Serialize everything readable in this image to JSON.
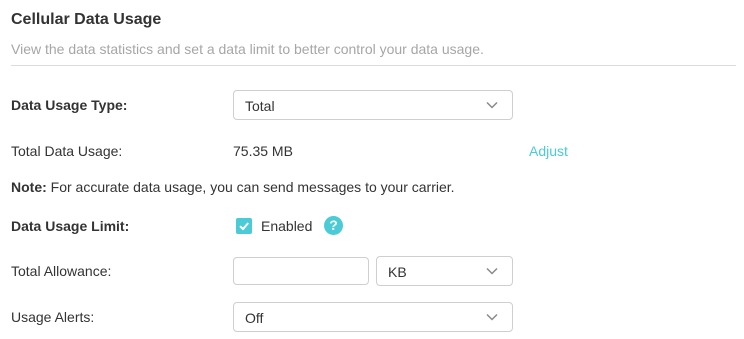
{
  "header": {
    "title": "Cellular Data Usage",
    "description": "View the data statistics and set a data limit to better control your data usage."
  },
  "data_usage_type": {
    "label": "Data Usage Type:",
    "selected": "Total"
  },
  "total_data_usage": {
    "label": "Total Data Usage:",
    "value": "75.35 MB",
    "adjust_link": "Adjust"
  },
  "note": {
    "prefix": "Note:",
    "text": " For accurate data usage, you can send messages to your carrier."
  },
  "data_usage_limit": {
    "label": "Data Usage Limit:",
    "checkbox_label": "Enabled",
    "checked": true,
    "help_icon": "question-icon"
  },
  "total_allowance": {
    "label": "Total Allowance:",
    "value": "",
    "placeholder": "",
    "unit_selected": "KB"
  },
  "usage_alerts": {
    "label": "Usage Alerts:",
    "selected": "Off"
  },
  "colors": {
    "accent": "#4acbd6",
    "text": "#333333",
    "muted": "#a6a6a6",
    "border": "#cfcfcf"
  }
}
